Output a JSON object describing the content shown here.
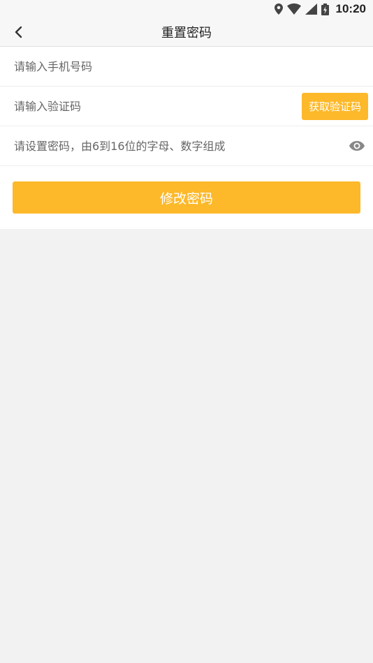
{
  "status_bar": {
    "time": "10:20",
    "icons": [
      "location-icon",
      "wifi-icon",
      "signal-icon",
      "battery-icon"
    ]
  },
  "nav": {
    "title": "重置密码",
    "back_icon": "chevron-left-icon"
  },
  "form": {
    "phone_placeholder": "请输入手机号码",
    "code_placeholder": "请输入验证码",
    "get_code_label": "获取验证码",
    "password_placeholder": "请设置密码，由6到16位的字母、数字组成",
    "eye_icon": "eye-icon"
  },
  "submit_label": "修改密码",
  "colors": {
    "accent": "#fdb92a",
    "background": "#f2f2f2",
    "card": "#ffffff"
  }
}
